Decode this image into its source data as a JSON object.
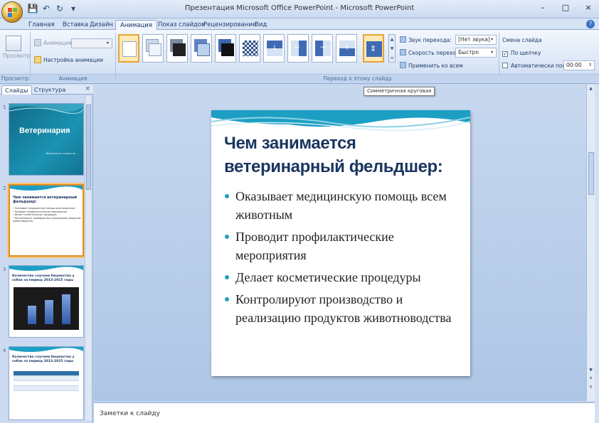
{
  "window": {
    "title": "Презентация Microsoft Office PowerPoint - Microsoft PowerPoint",
    "controls": {
      "minimize": "–",
      "maximize": "□",
      "close": "×"
    }
  },
  "quick_access": {
    "save": "💾",
    "undo": "↶",
    "redo": "↻",
    "more": "▾"
  },
  "tabs": [
    {
      "label": "Главная"
    },
    {
      "label": "Вставка"
    },
    {
      "label": "Дизайн"
    },
    {
      "label": "Анимация"
    },
    {
      "label": "Показ слайдов"
    },
    {
      "label": "Рецензирование"
    },
    {
      "label": "Вид"
    }
  ],
  "active_tab": "Анимация",
  "ribbon": {
    "preview": {
      "label": "Просмотр",
      "group": "Просмотр"
    },
    "animation": {
      "animate_label": "Анимация:",
      "custom_label": "Настройка анимации",
      "group": "Анимация"
    },
    "transition": {
      "group": "Переход к этому слайду",
      "sound_label": "Звук перехода:",
      "sound_value": "[Нет звука]",
      "speed_label": "Скорость перехода:",
      "speed_value": "Быстро",
      "apply_all_label": "Применить ко всем",
      "change_slide_label": "Смена слайда",
      "on_click_label": "По щелчку",
      "on_click_checked": true,
      "auto_after_label": "Автоматически после:",
      "auto_after_checked": false,
      "auto_after_value": "00:00"
    }
  },
  "tooltip": "Симметричная круговая",
  "left_panel": {
    "tab_slides": "Слайды",
    "tab_outline": "Структура",
    "close": "×",
    "slides": [
      {
        "num": "1",
        "title": "Ветеринария",
        "subtitle": "Выполнила студентка ..."
      },
      {
        "num": "2",
        "title": "Чем занимается ветеринарный фельдшер:",
        "lines": [
          "• Оказывает медицинскую помощь всем животным",
          "• Проводит профилактические мероприятия",
          "• Делает косметические процедуры",
          "• Контролируют производство и реализацию продуктов животноводства"
        ]
      },
      {
        "num": "3",
        "title": "Количество случаев бешенства у собак за период 2013-2015 годы"
      },
      {
        "num": "4",
        "title": "Количество случаев бешенства у собак за период 2013-2015 годы"
      }
    ]
  },
  "slide": {
    "title": "Чем занимается ветеринарный фельдшер:",
    "bullets": [
      "Оказывает медицинскую помощь всем животным",
      "Проводит профилактические мероприятия",
      "Делает косметические процедуры",
      "Контролируют производство и реализацию продуктов животноводства"
    ]
  },
  "notes": {
    "placeholder": "Заметки к слайду"
  },
  "colors": {
    "accent": "#1d9fc4",
    "title": "#1a355f",
    "ribbon": "#d9e5f6"
  }
}
